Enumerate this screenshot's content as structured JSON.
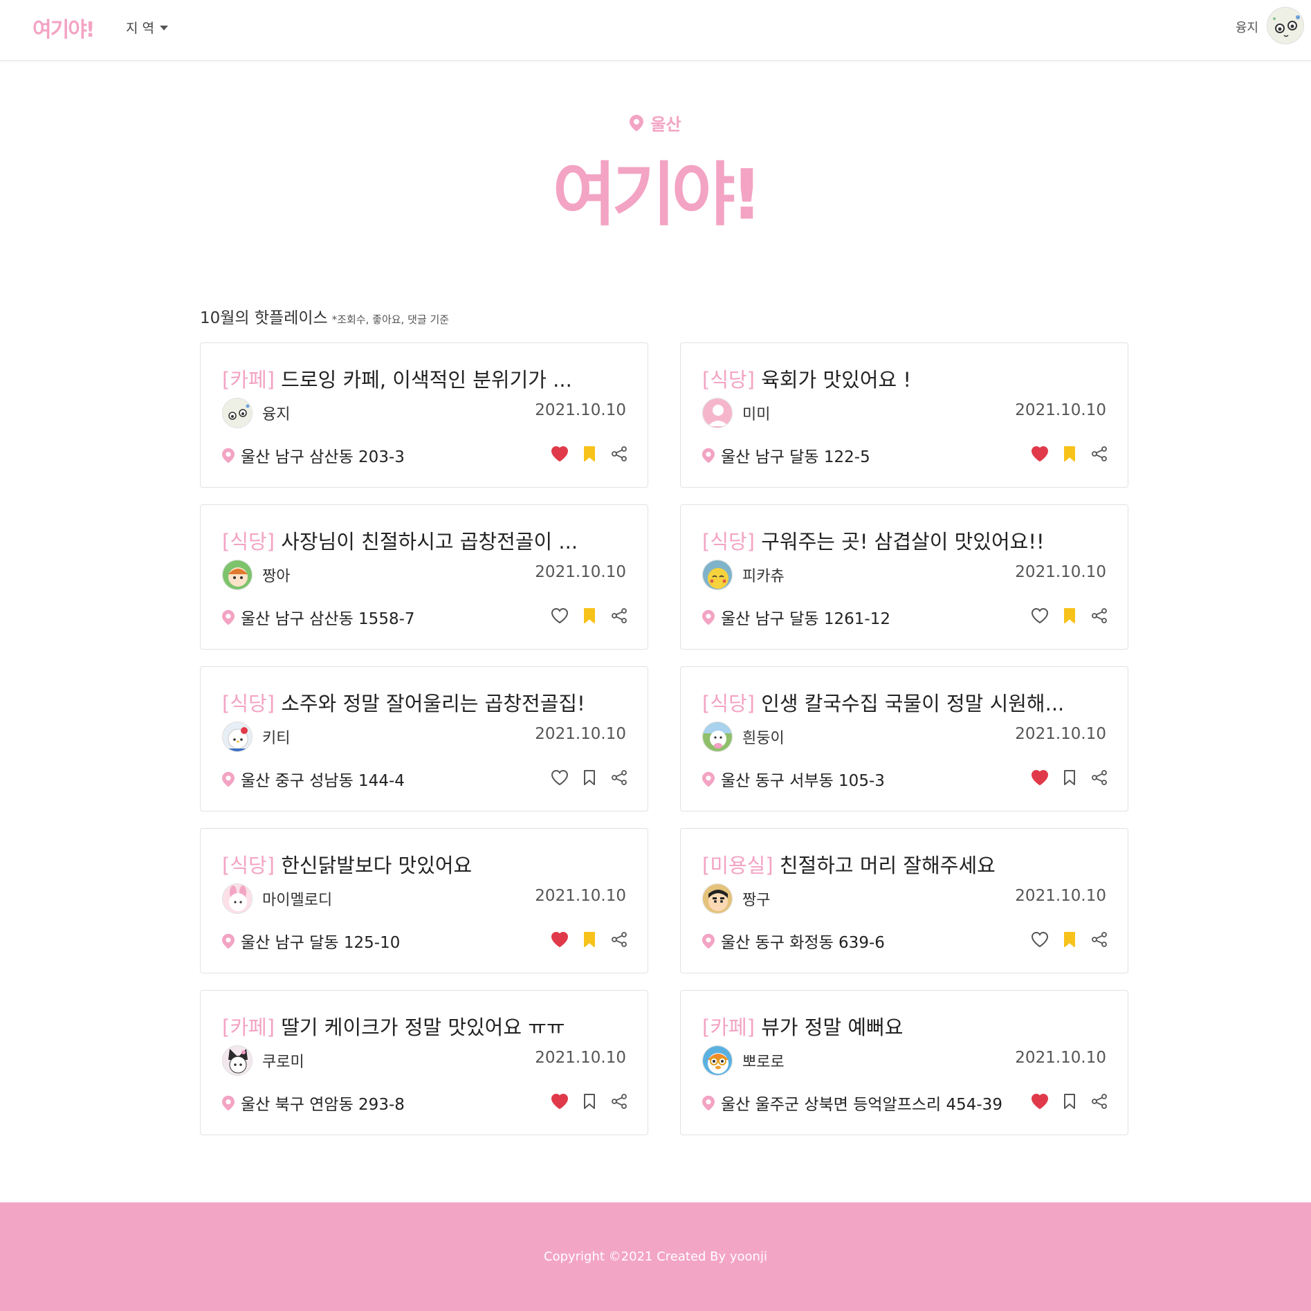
{
  "header": {
    "logo": "여기야!",
    "region_menu": "지 역",
    "user_name": "융지"
  },
  "hero": {
    "region": "울산",
    "title": "여기야!"
  },
  "section": {
    "title": "10월의 핫플레이스",
    "note": "*조회수, 좋아요, 댓글 기준"
  },
  "colors": {
    "brand_pink": "#f3a3c3",
    "heart_red": "#e03a4a",
    "bookmark_yellow": "#f7c21a",
    "footer_pink": "#f3a5c6"
  },
  "cards": [
    {
      "category": "[카페]",
      "title": "드로잉 카페, 이색적인 분위기가 ...",
      "author": "융지",
      "avatar": "yoonji",
      "date": "2021.10.10",
      "address": "울산 남구 삼산동 203-3",
      "liked": true,
      "bookmarked": true
    },
    {
      "category": "[식당]",
      "title": "육회가 맛있어요 !",
      "author": "미미",
      "avatar": "mimi",
      "date": "2021.10.10",
      "address": "울산 남구 달동 122-5",
      "liked": true,
      "bookmarked": true
    },
    {
      "category": "[식당]",
      "title": "사장님이 친절하시고 곱창전골이 ...",
      "author": "짱아",
      "avatar": "jjanga",
      "date": "2021.10.10",
      "address": "울산 남구 삼산동 1558-7",
      "liked": false,
      "bookmarked": true
    },
    {
      "category": "[식당]",
      "title": "구워주는 곳! 삼겹살이 맛있어요!!",
      "author": "피카츄",
      "avatar": "pikachu",
      "date": "2021.10.10",
      "address": "울산 남구 달동 1261-12",
      "liked": false,
      "bookmarked": true
    },
    {
      "category": "[식당]",
      "title": "소주와 정말 잘어울리는 곱창전골집!",
      "author": "키티",
      "avatar": "kitty",
      "date": "2021.10.10",
      "address": "울산 중구 성남동 144-4",
      "liked": false,
      "bookmarked": false
    },
    {
      "category": "[식당]",
      "title": "인생 칼국수집 국물이 정말 시원해...",
      "author": "흰둥이",
      "avatar": "whitey",
      "date": "2021.10.10",
      "address": "울산 동구 서부동 105-3",
      "liked": true,
      "bookmarked": false
    },
    {
      "category": "[식당]",
      "title": "한신닭발보다 맛있어요",
      "author": "마이멜로디",
      "avatar": "melody",
      "date": "2021.10.10",
      "address": "울산 남구 달동 125-10",
      "liked": true,
      "bookmarked": true
    },
    {
      "category": "[미용실]",
      "title": "친절하고 머리 잘해주세요",
      "author": "짱구",
      "avatar": "jjangu",
      "date": "2021.10.10",
      "address": "울산 동구 화정동 639-6",
      "liked": false,
      "bookmarked": true
    },
    {
      "category": "[카페]",
      "title": "딸기 케이크가 정말 맛있어요 ㅠㅠ",
      "author": "쿠로미",
      "avatar": "kuromi",
      "date": "2021.10.10",
      "address": "울산 북구 연암동 293-8",
      "liked": true,
      "bookmarked": false
    },
    {
      "category": "[카페]",
      "title": "뷰가 정말 예뻐요",
      "author": "뽀로로",
      "avatar": "pororo",
      "date": "2021.10.10",
      "address": "울산 울주군 상북면 등억알프스리 454-39",
      "liked": true,
      "bookmarked": false
    }
  ],
  "footer": {
    "text": "Copyright ©2021 Created By yoonji"
  }
}
